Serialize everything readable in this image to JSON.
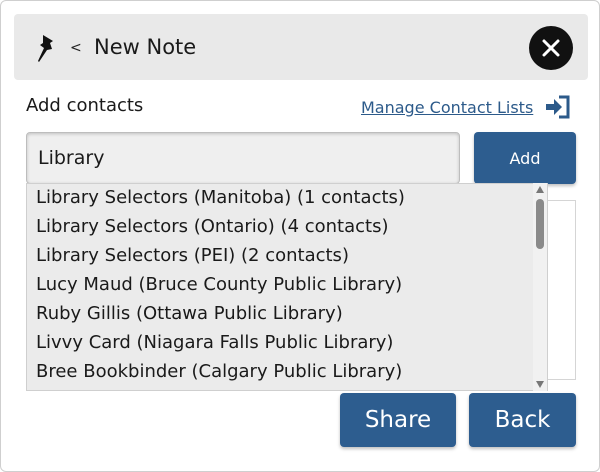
{
  "header": {
    "title": "New Note",
    "back_glyph": "<",
    "pin_icon": "pushpin-icon",
    "close_icon": "close-icon"
  },
  "contacts": {
    "label": "Add contacts",
    "manage_link": "Manage Contact Lists",
    "manage_icon": "sign-in-icon",
    "search_value": "Library",
    "add_label": "Add"
  },
  "suggestions": [
    "Library Selectors (Manitoba) (1 contacts)",
    "Library Selectors (Ontario) (4 contacts)",
    "Library Selectors (PEI) (2 contacts)",
    "Lucy Maud (Bruce County Public Library)",
    "Ruby Gillis (Ottawa Public Library)",
    "Livvy Card (Niagara Falls Public Library)",
    "Bree Bookbinder (Calgary Public Library)"
  ],
  "actions": {
    "share_label": "Share",
    "back_label": "Back"
  },
  "colors": {
    "primary_button": "#2d5d8f",
    "link": "#2c5a8a",
    "header_bg": "#e9e9e9",
    "close_button_bg": "#111111"
  }
}
